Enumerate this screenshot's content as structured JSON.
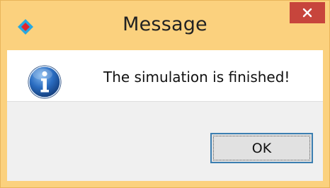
{
  "window": {
    "title": "Message"
  },
  "icons": {
    "app": "app-diamond-icon",
    "info": "information-icon",
    "close": "close-icon"
  },
  "body": {
    "message": "The simulation is finished!"
  },
  "buttons": {
    "ok_label": "OK"
  },
  "colors": {
    "frame": "#fbd17e",
    "close_button": "#c7453c",
    "ok_border": "#3c7fb1",
    "info_blue": "#1f5fae"
  }
}
